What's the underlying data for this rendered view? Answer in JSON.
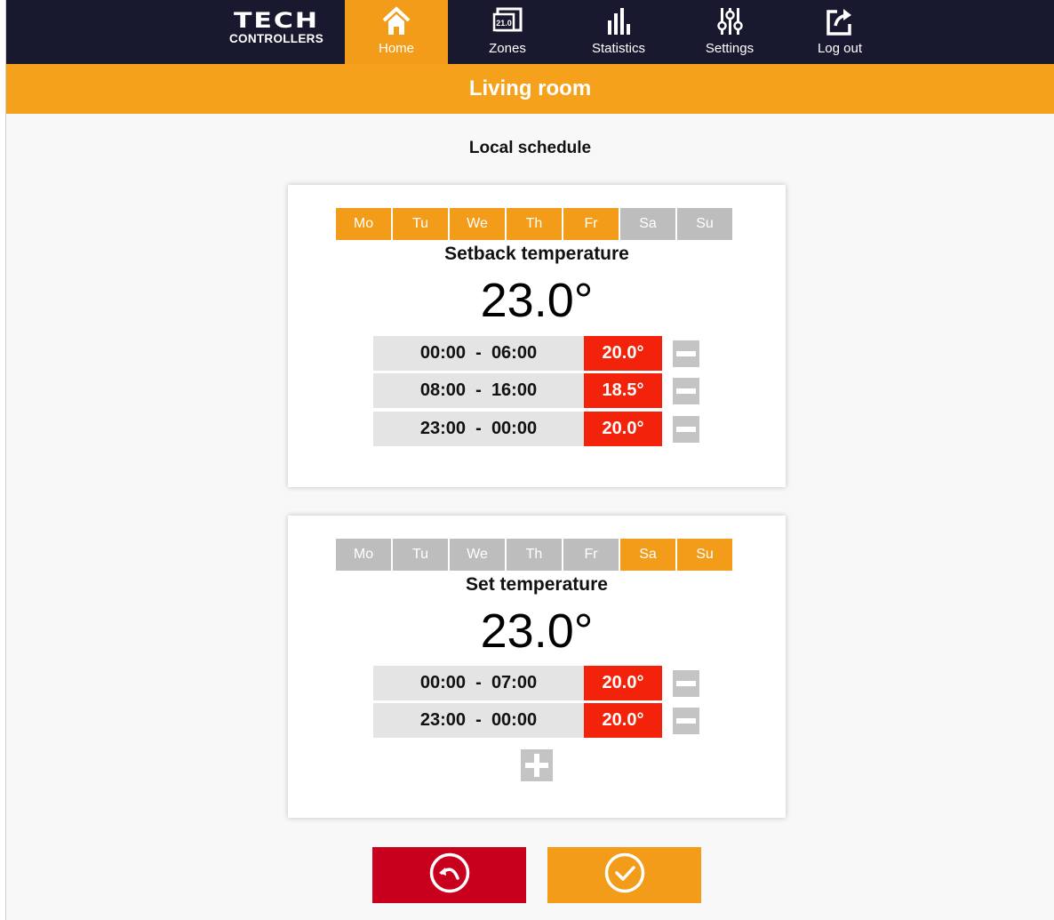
{
  "brand": {
    "line1": "TECH",
    "line2": "CONTROLLERS"
  },
  "nav": [
    {
      "label": "Home",
      "icon": "home-icon",
      "active": true
    },
    {
      "label": "Zones",
      "icon": "zones-icon",
      "active": false,
      "icon_text": "21.0"
    },
    {
      "label": "Statistics",
      "icon": "statistics-icon",
      "active": false
    },
    {
      "label": "Settings",
      "icon": "settings-sliders-icon",
      "active": false
    },
    {
      "label": "Log out",
      "icon": "logout-icon",
      "active": false
    }
  ],
  "page_title": "Living room",
  "section_heading": "Local schedule",
  "schedules": [
    {
      "days": [
        {
          "label": "Mo",
          "active": true
        },
        {
          "label": "Tu",
          "active": true
        },
        {
          "label": "We",
          "active": true
        },
        {
          "label": "Th",
          "active": true
        },
        {
          "label": "Fr",
          "active": true
        },
        {
          "label": "Sa",
          "active": false
        },
        {
          "label": "Su",
          "active": false
        }
      ],
      "label": "Setback temperature",
      "temperature": "23.0°",
      "intervals": [
        {
          "start": "00:00",
          "end": "06:00",
          "temperature": "20.0°"
        },
        {
          "start": "08:00",
          "end": "16:00",
          "temperature": "18.5°"
        },
        {
          "start": "23:00",
          "end": "00:00",
          "temperature": "20.0°"
        }
      ]
    },
    {
      "days": [
        {
          "label": "Mo",
          "active": false
        },
        {
          "label": "Tu",
          "active": false
        },
        {
          "label": "We",
          "active": false
        },
        {
          "label": "Th",
          "active": false
        },
        {
          "label": "Fr",
          "active": false
        },
        {
          "label": "Sa",
          "active": true
        },
        {
          "label": "Su",
          "active": true
        }
      ],
      "label": "Set temperature",
      "temperature": "23.0°",
      "intervals": [
        {
          "start": "00:00",
          "end": "07:00",
          "temperature": "20.0°"
        },
        {
          "start": "23:00",
          "end": "00:00",
          "temperature": "20.0°"
        }
      ]
    }
  ],
  "buttons": {
    "back": {
      "icon": "undo-circle-icon",
      "color": "#c8001e"
    },
    "confirm": {
      "icon": "check-circle-icon",
      "color": "#f39c19"
    }
  },
  "colors": {
    "header_bg": "#18192e",
    "accent": "#f39c19",
    "temp_badge": "#f2230a",
    "inactive": "#bdbdbd"
  }
}
